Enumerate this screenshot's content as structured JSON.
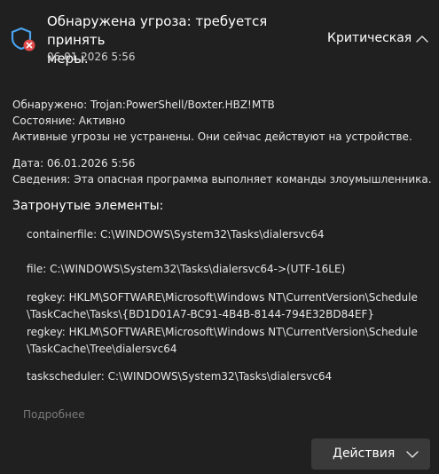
{
  "header": {
    "title_line1": "Обнаружена угроза: требуется принять",
    "title_line2": "меры.",
    "date": "06.01.2026 5:56",
    "severity": "Критическая"
  },
  "details": {
    "detected_label": "Обнаружено:",
    "detected_value": "Trojan:PowerShell/Boxter.HBZ!MTB",
    "status_label": "Состояние:",
    "status_value": "Активно",
    "status_note": "Активные угрозы не устранены. Они сейчас действуют на устройстве.",
    "date_label": "Дата:",
    "date_value": "06.01.2026 5:56",
    "info_label": "Сведения:",
    "info_value": "Эта опасная программа выполняет команды злоумышленника."
  },
  "affected": {
    "title": "Затронутые элементы:",
    "items": [
      {
        "line1": "containerfile: C:\\WINDOWS\\System32\\Tasks\\dialersvc64",
        "line2": ""
      },
      {
        "line1": "file: C:\\WINDOWS\\System32\\Tasks\\dialersvc64->(UTF-16LE)",
        "line2": ""
      },
      {
        "line1": "regkey: HKLM\\SOFTWARE\\Microsoft\\Windows NT\\CurrentVersion\\Schedule",
        "line2": "\\TaskCache\\Tasks\\{BD1D01A7-BC91-4B4B-8144-794E32BD84EF}"
      },
      {
        "line1": "regkey: HKLM\\SOFTWARE\\Microsoft\\Windows NT\\CurrentVersion\\Schedule",
        "line2": "\\TaskCache\\Tree\\dialersvc64"
      },
      {
        "line1": "taskscheduler: C:\\WINDOWS\\System32\\Tasks\\dialersvc64",
        "line2": ""
      }
    ]
  },
  "more_link": "Подробнее",
  "actions_button": "Действия",
  "icons": {
    "shield": "shield-alert-icon",
    "severity_chevron": "chevron-up-icon",
    "actions_chevron": "chevron-down-icon"
  },
  "colors": {
    "background": "#202020",
    "shield_blue": "#4aa3f0",
    "alert_red": "#e04a4a",
    "button_bg": "#3a3a3a",
    "muted_link": "#7a7a7a"
  }
}
